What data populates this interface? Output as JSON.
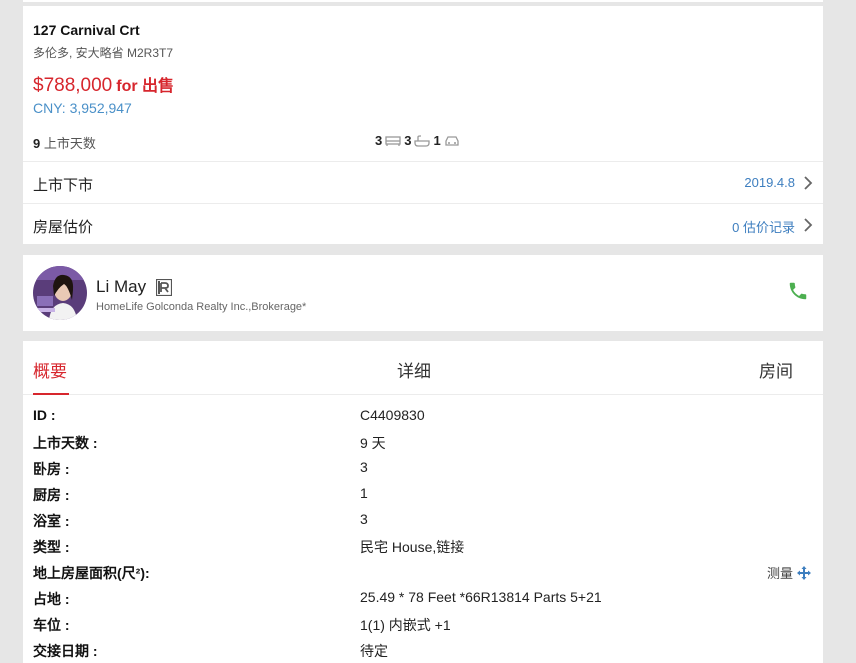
{
  "listing": {
    "address": "127 Carnival Crt",
    "city_line": "多伦多, 安大略省 M2R3T7",
    "price": "$788,000",
    "price_type": "for 出售",
    "cny": "CNY: 3,952,947",
    "days_number": "9",
    "days_label": "上市天数",
    "bedrooms": "3",
    "bathrooms": "3",
    "parking": "1",
    "history_label": "上市下市",
    "history_value": "2019.4.8",
    "estimate_label": "房屋估价",
    "estimate_value": "0 估价记录"
  },
  "agent": {
    "name": "Li May",
    "brokerage": "HomeLife Golconda Realty Inc.,Brokerage*"
  },
  "tabs": [
    {
      "label": "概要"
    },
    {
      "label": "详细"
    },
    {
      "label": "房间"
    }
  ],
  "details": [
    {
      "key": "ID :",
      "value": "C4409830"
    },
    {
      "key": "上市天数 :",
      "value": "9 天"
    },
    {
      "key": "卧房 :",
      "value": "3"
    },
    {
      "key": "厨房 :",
      "value": "1"
    },
    {
      "key": "浴室 :",
      "value": "3"
    },
    {
      "key": "类型 :",
      "value": "民宅 House,链接"
    },
    {
      "key": "地上房屋面积(尺²):",
      "value": ""
    },
    {
      "key": "占地 :",
      "value": "25.49 * 78 Feet *66R13814 Parts 5+21"
    },
    {
      "key": "车位 :",
      "value": "1(1) 内嵌式 +1"
    },
    {
      "key": "交接日期 :",
      "value": "待定"
    }
  ],
  "measure_label": "测量",
  "colors": {
    "accent_red": "#d7262d",
    "link_blue": "#3d7ebf",
    "phone_green": "#4caf50"
  },
  "icons": [
    "bed-icon",
    "bath-icon",
    "car-icon",
    "chevron-right-icon",
    "realtor-icon",
    "phone-icon",
    "move-icon"
  ]
}
